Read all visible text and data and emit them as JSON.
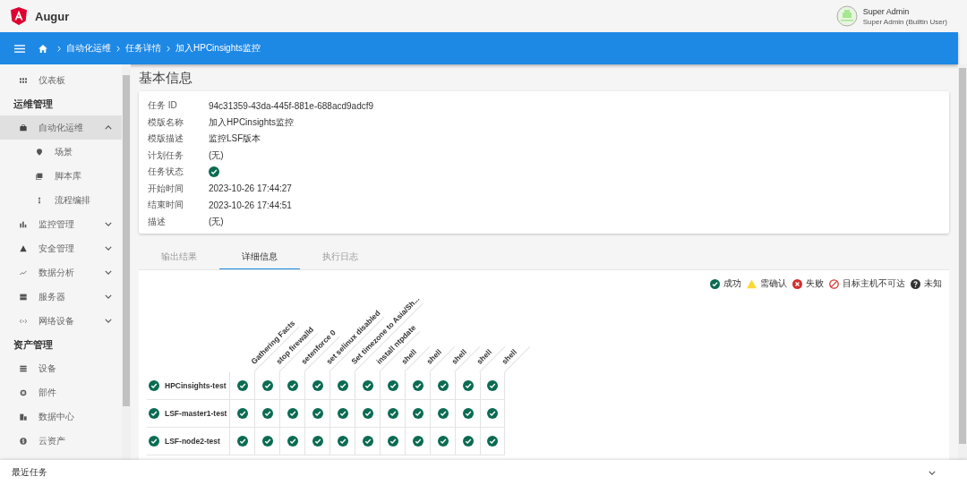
{
  "app": {
    "name": "Augur"
  },
  "user": {
    "name": "Super Admin",
    "role": "Super Admin (Builtin User)"
  },
  "breadcrumb": [
    "自动化运维",
    "任务详情",
    "加入HPCinsights监控"
  ],
  "sidebar": [
    {
      "kind": "item",
      "label": "仪表板",
      "selected": false
    },
    {
      "kind": "section",
      "label": "运维管理"
    },
    {
      "kind": "item",
      "label": "自动化运维",
      "selected": true,
      "expanded": true,
      "children": [
        {
          "label": "场景",
          "selected": false
        },
        {
          "label": "脚本库",
          "selected": false
        },
        {
          "label": "流程编排",
          "selected": false
        }
      ]
    },
    {
      "kind": "item",
      "label": "监控管理",
      "selected": false,
      "expanded": false
    },
    {
      "kind": "item",
      "label": "安全管理",
      "selected": false,
      "expanded": false
    },
    {
      "kind": "item",
      "label": "数据分析",
      "selected": false,
      "expanded": false
    },
    {
      "kind": "item",
      "label": "服务器",
      "selected": false,
      "expanded": false
    },
    {
      "kind": "item",
      "label": "网络设备",
      "selected": false,
      "expanded": false
    },
    {
      "kind": "section",
      "label": "资产管理"
    },
    {
      "kind": "item",
      "label": "设备",
      "selected": false
    },
    {
      "kind": "item",
      "label": "部件",
      "selected": false
    },
    {
      "kind": "item",
      "label": "数据中心",
      "selected": false
    },
    {
      "kind": "item",
      "label": "云资产",
      "selected": false
    }
  ],
  "basic_info": {
    "title": "基本信息",
    "fields": [
      {
        "label": "任务 ID",
        "kind": "text",
        "value": "94c31359-43da-445f-881e-688acd9adcf9"
      },
      {
        "label": "模版名称",
        "kind": "text",
        "value": "加入HPCinsights监控"
      },
      {
        "label": "模版描述",
        "kind": "text",
        "value": "监控LSF版本"
      },
      {
        "label": "计划任务",
        "kind": "text",
        "value": "(无)"
      },
      {
        "label": "任务状态",
        "kind": "status",
        "ok": true
      },
      {
        "label": "开始时间",
        "kind": "text",
        "value": "2023-10-26 17:44:27"
      },
      {
        "label": "结束时间",
        "kind": "text",
        "value": "2023-10-26 17:44:51"
      },
      {
        "label": "描述",
        "kind": "text",
        "value": "(无)"
      }
    ]
  },
  "tabs": [
    {
      "label": "输出结果",
      "selected": false
    },
    {
      "label": "详细信息",
      "selected": true
    },
    {
      "label": "执行日志",
      "selected": false
    }
  ],
  "legend": [
    {
      "kind": "success",
      "label": "成功"
    },
    {
      "kind": "warning",
      "label": "需确认"
    },
    {
      "kind": "failed",
      "label": "失败"
    },
    {
      "kind": "unreachable",
      "label": "目标主机不可达"
    },
    {
      "kind": "unknown",
      "label": "未知"
    }
  ],
  "matrix": {
    "columns": [
      "Gathering Facts",
      "stop firewalld",
      "setenforce 0",
      "set selinux disabled",
      "Set timezone to Asia/Sh...",
      "install ntpdate",
      "shell",
      "shell",
      "shell",
      "shell",
      "shell"
    ],
    "rows": [
      {
        "host": "HPCinsights-test",
        "ok": true,
        "results": [
          {
            "ok": true
          },
          {
            "ok": true
          },
          {
            "ok": true
          },
          {
            "ok": true
          },
          {
            "ok": true
          },
          {
            "ok": true
          },
          {
            "ok": true
          },
          {
            "ok": true
          },
          {
            "ok": true
          },
          {
            "ok": true
          },
          {
            "ok": true
          }
        ]
      },
      {
        "host": "LSF-master1-test",
        "ok": true,
        "results": [
          {
            "ok": true
          },
          {
            "ok": true
          },
          {
            "ok": true
          },
          {
            "ok": true
          },
          {
            "ok": true
          },
          {
            "ok": true
          },
          {
            "ok": true
          },
          {
            "ok": true
          },
          {
            "ok": true
          },
          {
            "ok": true
          },
          {
            "ok": true
          }
        ]
      },
      {
        "host": "LSF-node2-test",
        "ok": true,
        "results": [
          {
            "ok": true
          },
          {
            "ok": true
          },
          {
            "ok": true
          },
          {
            "ok": true
          },
          {
            "ok": true
          },
          {
            "ok": true
          },
          {
            "ok": true
          },
          {
            "ok": true
          },
          {
            "ok": true
          },
          {
            "ok": true
          },
          {
            "ok": true
          }
        ]
      }
    ]
  },
  "bottom_bar": {
    "label": "最近任务"
  }
}
